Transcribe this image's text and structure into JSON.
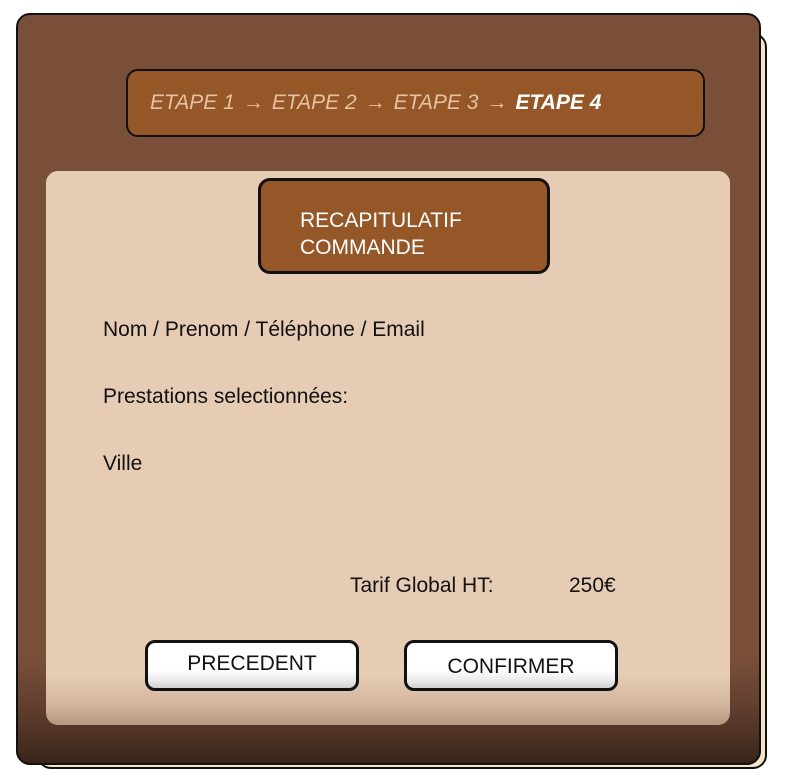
{
  "stepper": {
    "steps": [
      "ETAPE 1",
      "ETAPE 2",
      "ETAPE 3",
      "ETAPE 4"
    ],
    "arrow": "→",
    "current_step": "ETAPE 4"
  },
  "summary": {
    "title_line1": "RECAPITULATIF",
    "title_line2": "COMMANDE",
    "customer_label": "Nom / Prenom / Téléphone / Email",
    "services_label": "Prestations selectionnées:",
    "city_label": "Ville",
    "total_label": "Tarif Global HT:",
    "total_value": "250€"
  },
  "actions": {
    "previous_label": "PRECEDENT",
    "confirm_label": "CONFIRMER"
  },
  "colors": {
    "card_background": "#7a4f3a",
    "accent": "#955628",
    "panel_background": "#e6ccb5",
    "current_step_text": "#ffffff",
    "inactive_step_text": "#e7c1a1"
  }
}
